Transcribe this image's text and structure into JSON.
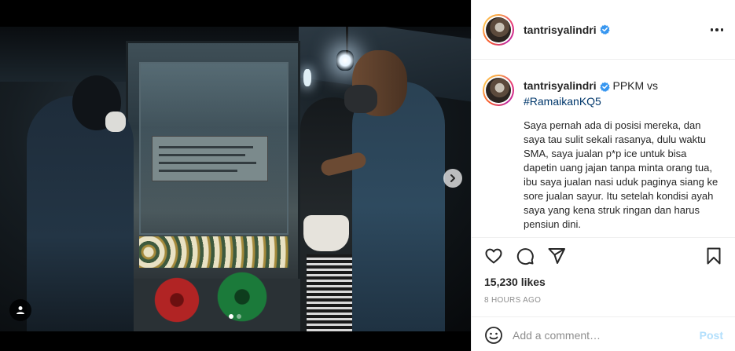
{
  "post": {
    "username": "tantrisyalindri",
    "verified": true,
    "caption": {
      "head_text": "PPKM vs",
      "hashtag": "#RamaikanKQ5",
      "body": "Saya pernah ada di posisi mereka, dan saya tau sulit sekali rasanya, dulu waktu SMA, saya jualan p*p ice untuk bisa dapetin uang jajan tanpa minta orang tua, ibu saya jualan nasi uduk paginya siang ke sore jualan sayur. Itu setelah kondisi ayah saya yang kena struk ringan dan harus pensiun dini."
    },
    "likes": "15,230 likes",
    "time_ago": "8 HOURS AGO",
    "carousel": {
      "total": 2,
      "current": 1
    }
  },
  "comment": {
    "placeholder": "Add a comment…",
    "post_label": "Post"
  },
  "icons": {
    "more": "more-options-icon",
    "like": "heart-icon",
    "comment": "comment-icon",
    "share": "paper-plane-icon",
    "save": "bookmark-icon",
    "emoji": "emoji-icon",
    "next": "chevron-right-icon",
    "tag": "user-tag-icon",
    "verified": "verified-badge-icon"
  },
  "colors": {
    "link": "#00376b",
    "verified": "#3897f0",
    "post_button_disabled": "#b2dffc",
    "muted": "#8e8e8e"
  }
}
